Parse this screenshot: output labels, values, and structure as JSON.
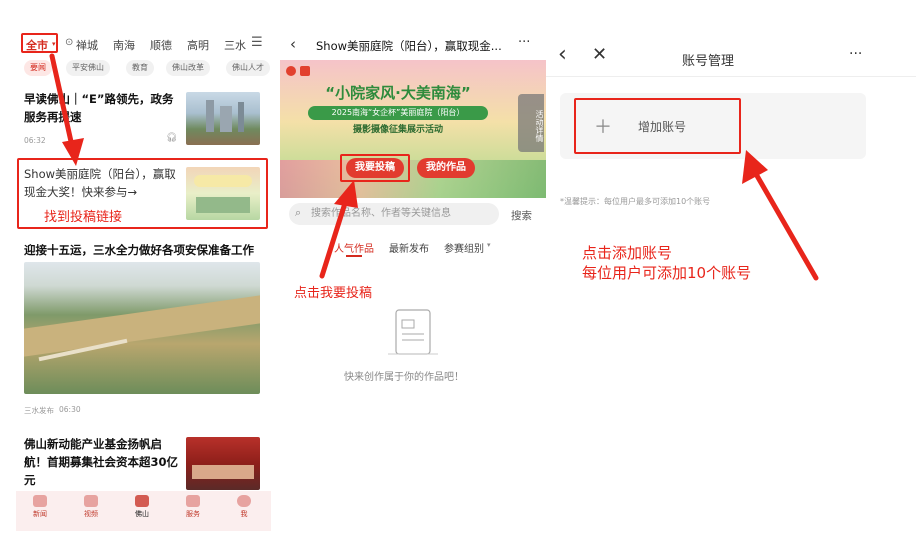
{
  "panel1": {
    "nav_tabs": [
      "全市",
      "禅城",
      "南海",
      "顺德",
      "高明",
      "三水"
    ],
    "chips": [
      "要闻",
      "平安佛山",
      "教育",
      "佛山改革",
      "佛山人才"
    ],
    "news": [
      {
        "title": "早读佛山｜“E”路领先，政务服务再提速",
        "time": "06:32"
      },
      {
        "title": "Show美丽庭院（阳台），赢取现金大奖！快来参与→"
      },
      {
        "title": "迎接十五运，三水全力做好各项安保准备工作",
        "source": "三水发布",
        "time": "06:30"
      },
      {
        "title": "佛山新动能产业基金扬帆启航！首期募集社会资本超30亿元"
      }
    ],
    "tabbar": [
      "新闻",
      "视频",
      "佛山",
      "服务",
      "我"
    ],
    "annotation": "找到投稿链接"
  },
  "panel2": {
    "title": "Show美丽庭院（阳台），赢取现金...",
    "banner_title": "“小院家风·大美南海”",
    "banner_subtitle": "2025南海“女企杯”美丽庭院（阳台）",
    "banner_subtitle2": "摄影摄像征集展示活动",
    "side_tag": "活动详情",
    "buttons": [
      "我要投稿",
      "我的作品"
    ],
    "search_placeholder": "搜索作品名称、作者等关键信息",
    "search_button": "搜索",
    "content_tabs": [
      "人气作品",
      "最新发布",
      "参赛组别"
    ],
    "empty_text": "快来创作属于你的作品吧！",
    "annotation": "点击我要投稿"
  },
  "panel3": {
    "title": "账号管理",
    "add_label": "增加账号",
    "hint": "*温馨提示：每位用户最多可添加10个账号",
    "annotation_line1": "点击添加账号",
    "annotation_line2": "每位用户可添加10个账号"
  },
  "colors": {
    "accent_red": "#e8251b",
    "brand_red": "#d42a1e"
  }
}
